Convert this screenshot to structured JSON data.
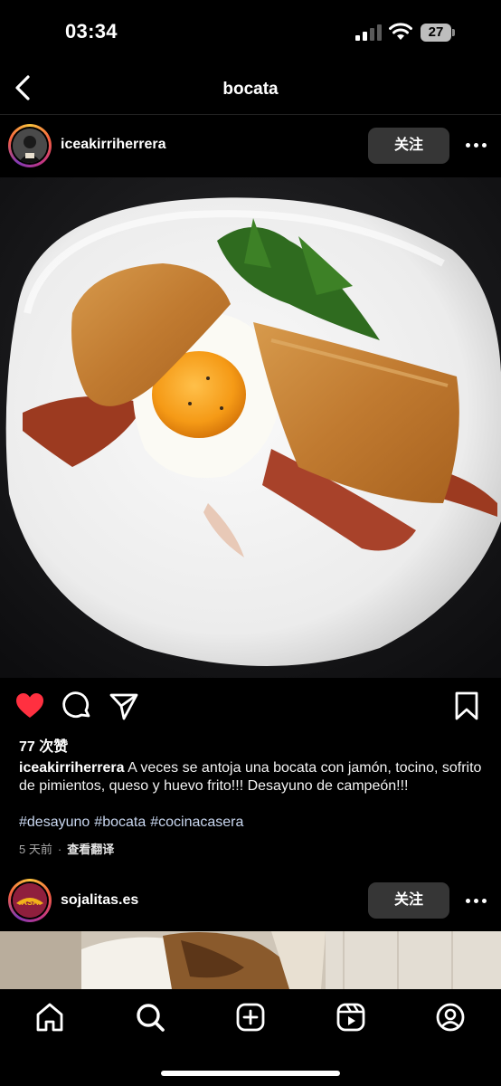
{
  "status_bar": {
    "time": "03:34",
    "battery": "27"
  },
  "nav": {
    "title": "bocata"
  },
  "post1": {
    "username": "iceakirriherrera",
    "follow_label": "关注",
    "likes": "77 次赞",
    "caption_user": "iceakirriherrera",
    "caption_text": "A veces se antoja una bocata con jamón, tocino, sofrito de pimientos, queso y huevo frito!!! Desayuno de campeón!!!",
    "hashtags": [
      "#desayuno",
      "#bocata",
      "#cocinacasera"
    ],
    "time_ago": "5 天前",
    "translate_label": "查看翻译",
    "liked": true
  },
  "post2": {
    "username": "sojalitas.es",
    "follow_label": "关注"
  },
  "icons": {
    "status": [
      "signal-icon",
      "wifi-icon",
      "battery-icon"
    ],
    "nav": [
      "back-icon"
    ],
    "actions": [
      "heart-icon",
      "comment-icon",
      "share-icon",
      "bookmark-icon"
    ],
    "tabs": [
      "home-icon",
      "search-icon",
      "create-icon",
      "reels-icon",
      "profile-icon"
    ]
  },
  "colors": {
    "like": "#ff3040",
    "follow_bg": "#363636",
    "hashtag": "#c8d6ef"
  }
}
